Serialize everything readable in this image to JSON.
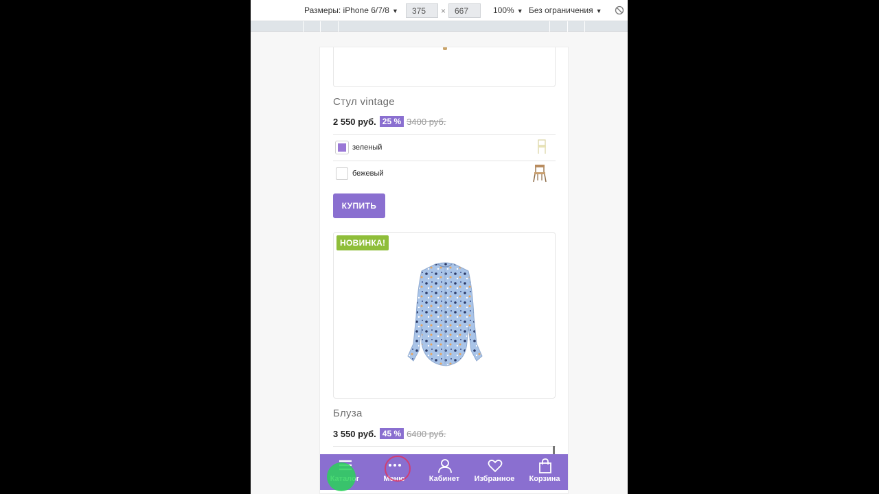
{
  "toolbar": {
    "device_label": "Размеры: iPhone 6/7/8",
    "width_value": "375",
    "times_sign": "×",
    "height_value": "667",
    "zoom": "100%",
    "throttling": "Без ограничения",
    "rotate_icon": "rotate-icon"
  },
  "products": [
    {
      "title": "Стул vintage",
      "price": "2 550 руб.",
      "discount": "25 %",
      "old_price": "3400 руб.",
      "variants": [
        {
          "label": "зеленый",
          "selected": true,
          "thumb_icon": "chair-green-icon"
        },
        {
          "label": "бежевый",
          "selected": false,
          "thumb_icon": "chair-beige-icon"
        }
      ],
      "buy_label": "КУПИТЬ"
    },
    {
      "badge": "НОВИНКА!",
      "image_icon": "blouse-image",
      "title": "Блуза",
      "price": "3 550 руб.",
      "discount": "45 %",
      "old_price": "6400 руб."
    }
  ],
  "bottom_nav": [
    {
      "label": "Каталог",
      "icon": "hamburger-icon"
    },
    {
      "label": "Меню",
      "icon": "dots-icon"
    },
    {
      "label": "Кабинет",
      "icon": "user-icon"
    },
    {
      "label": "Избранное",
      "icon": "heart-icon"
    },
    {
      "label": "Корзина",
      "icon": "bag-icon"
    }
  ],
  "colors": {
    "accent": "#8a6fd0",
    "new_badge": "#8fbe3a",
    "tap_indicator": "#2ad25a"
  }
}
